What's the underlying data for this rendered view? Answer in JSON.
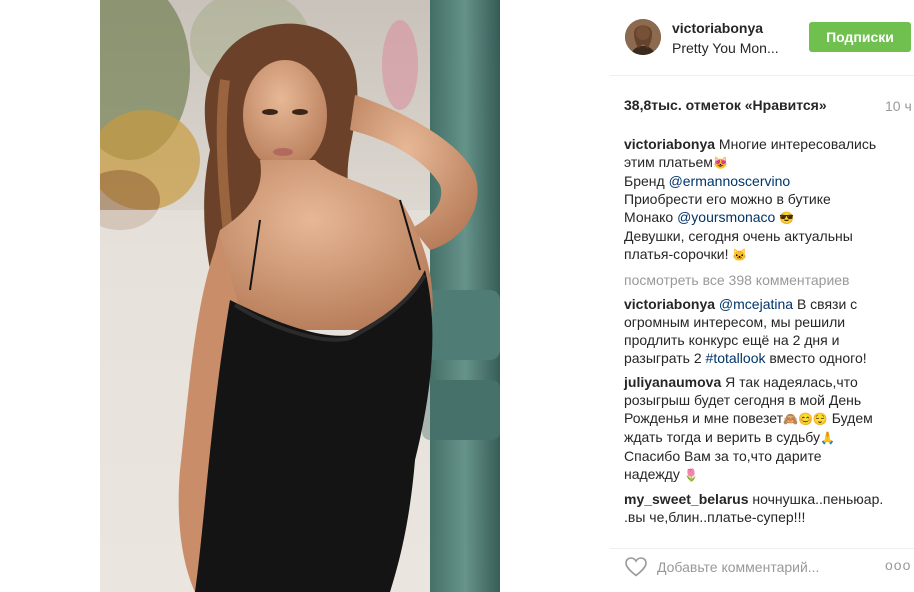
{
  "post": {
    "username": "victoriabonya",
    "location": "Pretty You Mon...",
    "follow_label": "Подписки",
    "likes": "38,8тыс. отметок «Нравится»",
    "time": "10 ч"
  },
  "caption": {
    "username": "victoriabonya",
    "lines": [
      "Многие интересовались",
      "этим платьем",
      "Бренд ",
      "@ermannoscervino",
      "Приобрести его можно в бутике",
      "Монако ",
      "@yoursmonaco",
      "Девушки, сегодня очень актуальны",
      "платья-сорочки! "
    ]
  },
  "view_all": "посмотреть все 398 комментариев",
  "comments": [
    {
      "username": "victoriabonya",
      "mention": "@mcejatina",
      "text_a": " В связи с",
      "text_b": "огромным интересом, мы решили",
      "text_c": "продлить конкурс ещё на 2 дня и",
      "text_d": "разыграть 2 ",
      "hashtag": "#totallook",
      "text_e": " вместо одного!"
    },
    {
      "username": "juliyanaumova",
      "text_a": " Я так надеялась,что",
      "text_b": "розыгрыш будет сегодня в мой День",
      "text_c": "Рожденья и мне повезет",
      "text_c2": " Будем",
      "text_d": "ждать тогда и верить в судьбу",
      "text_e": "Спасибо Вам за то,что дарите",
      "text_f": "надежду "
    },
    {
      "username": "my_sweet_belarus",
      "text_a": " ночнушка..пеньюар.",
      "text_b": ".вы че,блин..платье-супер!!!"
    }
  ],
  "add_comment_placeholder": "Добавьте комментарий...",
  "more_label": "ооо",
  "colors": {
    "follow_green": "#70c050",
    "mention_blue": "#003569",
    "muted_gray": "#999999"
  },
  "icons": [
    "heart-icon",
    "more-options-icon"
  ]
}
